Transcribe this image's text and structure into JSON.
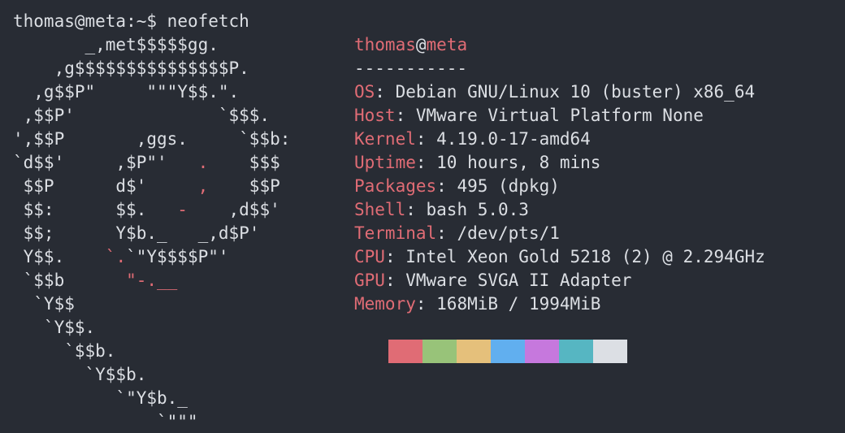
{
  "prompt": {
    "user_host": "thomas@meta",
    "path_symbol": ":~$",
    "command": "neofetch"
  },
  "logo": {
    "lines": [
      [
        {
          "t": "       _,met$$$$$gg."
        }
      ],
      [
        {
          "t": "    ,g$$$$$$$$$$$$$$$P."
        }
      ],
      [
        {
          "t": "  ,g$$P\"     \"\"\"Y$$.\"."
        }
      ],
      [
        {
          "t": " ,$$P'              `$$$."
        }
      ],
      [
        {
          "t": "',$$P       ,ggs.     `$$b:"
        }
      ],
      [
        {
          "t": "`d$$'     ,$P\"'   "
        },
        {
          "t": ".",
          "red": true
        },
        {
          "t": "    $$$"
        }
      ],
      [
        {
          "t": " $$P      d$'     "
        },
        {
          "t": ",",
          "red": true
        },
        {
          "t": "    $$P"
        }
      ],
      [
        {
          "t": " $$:      $$.   "
        },
        {
          "t": "-",
          "red": true
        },
        {
          "t": "    ,d$$'"
        }
      ],
      [
        {
          "t": " $$;      Y$b._   _,d$P'"
        }
      ],
      [
        {
          "t": " Y$$.    "
        },
        {
          "t": "`.",
          "red": true
        },
        {
          "t": "`\"Y$$$$P\"'"
        }
      ],
      [
        {
          "t": " `$$b      "
        },
        {
          "t": "\"-.__",
          "red": true
        }
      ],
      [
        {
          "t": "  `Y$$"
        }
      ],
      [
        {
          "t": "   `Y$$."
        }
      ],
      [
        {
          "t": "     `$$b."
        }
      ],
      [
        {
          "t": "       `Y$$b."
        }
      ],
      [
        {
          "t": "          `\"Y$b._"
        }
      ],
      [
        {
          "t": "              `\"\"\""
        }
      ]
    ]
  },
  "info": {
    "user": "thomas",
    "at": "@",
    "host": "meta",
    "separator": "-----------",
    "fields": [
      {
        "key": "OS",
        "value": "Debian GNU/Linux 10 (buster) x86_64"
      },
      {
        "key": "Host",
        "value": "VMware Virtual Platform None"
      },
      {
        "key": "Kernel",
        "value": "4.19.0-17-amd64"
      },
      {
        "key": "Uptime",
        "value": "10 hours, 8 mins"
      },
      {
        "key": "Packages",
        "value": "495 (dpkg)"
      },
      {
        "key": "Shell",
        "value": "bash 5.0.3"
      },
      {
        "key": "Terminal",
        "value": "/dev/pts/1"
      },
      {
        "key": "CPU",
        "value": "Intel Xeon Gold 5218 (2) @ 2.294GHz"
      },
      {
        "key": "GPU",
        "value": "VMware SVGA II Adapter"
      },
      {
        "key": "Memory",
        "value": "168MiB / 1994MiB"
      }
    ]
  },
  "palette": [
    "#e06c75",
    "#98c379",
    "#e5c07b",
    "#61afef",
    "#c678dd",
    "#56b6c2",
    "#dcdfe4"
  ]
}
